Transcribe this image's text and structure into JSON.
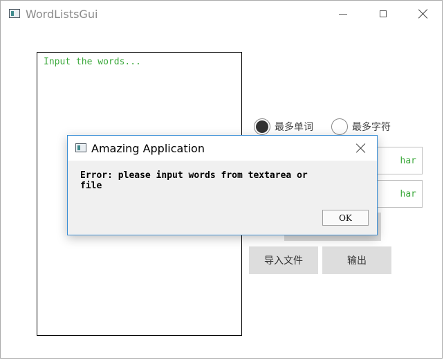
{
  "window": {
    "title": "WordListsGui",
    "controls": {
      "minimize": "minimize",
      "maximize": "maximize",
      "close": "close"
    }
  },
  "textarea": {
    "placeholder": "Input the words..."
  },
  "options": {
    "radio_words_label": "最多单词",
    "radio_chars_label": "最多字符",
    "selected": "radio_words"
  },
  "fields": [
    {
      "value": "har"
    },
    {
      "value": "har"
    }
  ],
  "buttons": {
    "import_label": "导入文件",
    "output_label": "输出"
  },
  "dialog": {
    "title": "Amazing Application",
    "message": "Error: please input words from textarea or\nfile",
    "ok_label": "OK"
  }
}
